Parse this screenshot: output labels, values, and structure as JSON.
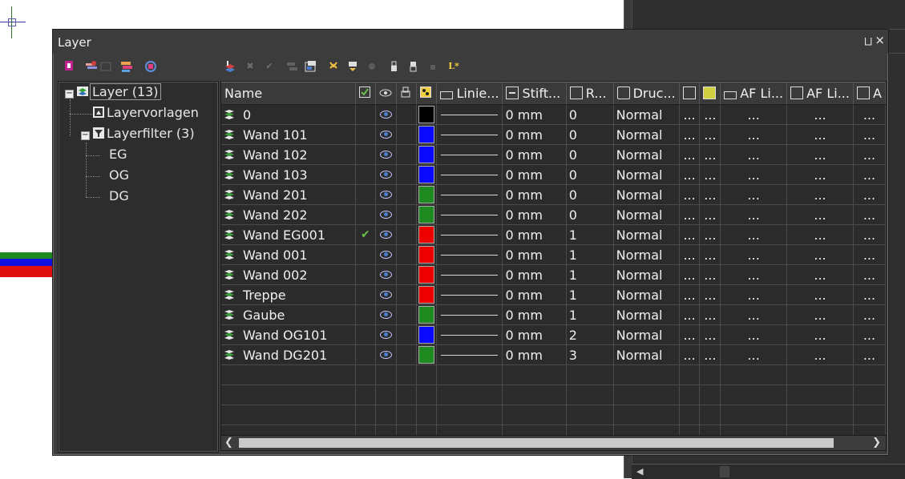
{
  "window": {
    "title": "Layer",
    "pin_label": "⨆",
    "close_label": "×"
  },
  "tree": {
    "root": "Layer (13)",
    "templates": "Layervorlagen",
    "filters": "Layerfilter (3)",
    "filter_items": [
      "EG",
      "OG",
      "DG"
    ]
  },
  "columns": {
    "name": "Name",
    "line": "Linie...",
    "pen": "Stift...",
    "r": "R...",
    "print": "Druc...",
    "af1": "AF Li...",
    "af2": "AF Li...",
    "last": "A"
  },
  "rows": [
    {
      "name": "0",
      "current": "",
      "color": "#000000",
      "pen": "0 mm",
      "r": "0",
      "print": "Normal"
    },
    {
      "name": "Wand 101",
      "current": "",
      "color": "#0a0aff",
      "pen": "0 mm",
      "r": "0",
      "print": "Normal"
    },
    {
      "name": "Wand 102",
      "current": "",
      "color": "#0a0aff",
      "pen": "0 mm",
      "r": "0",
      "print": "Normal"
    },
    {
      "name": "Wand 103",
      "current": "",
      "color": "#0a0aff",
      "pen": "0 mm",
      "r": "0",
      "print": "Normal"
    },
    {
      "name": "Wand 201",
      "current": "",
      "color": "#1f8a1f",
      "pen": "0 mm",
      "r": "0",
      "print": "Normal"
    },
    {
      "name": "Wand 202",
      "current": "",
      "color": "#1f8a1f",
      "pen": "0 mm",
      "r": "0",
      "print": "Normal"
    },
    {
      "name": "Wand EG001",
      "current": "✔",
      "color": "#ee0000",
      "pen": "0 mm",
      "r": "1",
      "print": "Normal"
    },
    {
      "name": "Wand 001",
      "current": "",
      "color": "#ee0000",
      "pen": "0 mm",
      "r": "1",
      "print": "Normal"
    },
    {
      "name": "Wand 002",
      "current": "",
      "color": "#ee0000",
      "pen": "0 mm",
      "r": "1",
      "print": "Normal"
    },
    {
      "name": "Treppe",
      "current": "",
      "color": "#ee0000",
      "pen": "0 mm",
      "r": "1",
      "print": "Normal"
    },
    {
      "name": "Gaube",
      "current": "",
      "color": "#1f8a1f",
      "pen": "0 mm",
      "r": "1",
      "print": "Normal"
    },
    {
      "name": "Wand OG101",
      "current": "",
      "color": "#0a0aff",
      "pen": "0 mm",
      "r": "2",
      "print": "Normal"
    },
    {
      "name": "Wand DG201",
      "current": "",
      "color": "#1f8a1f",
      "pen": "0 mm",
      "r": "3",
      "print": "Normal"
    }
  ],
  "ellipsis": "...",
  "toolbar_new_label": "L*",
  "background_stripes": [
    "#1f8a1f",
    "#1010e0",
    "#e01010"
  ]
}
